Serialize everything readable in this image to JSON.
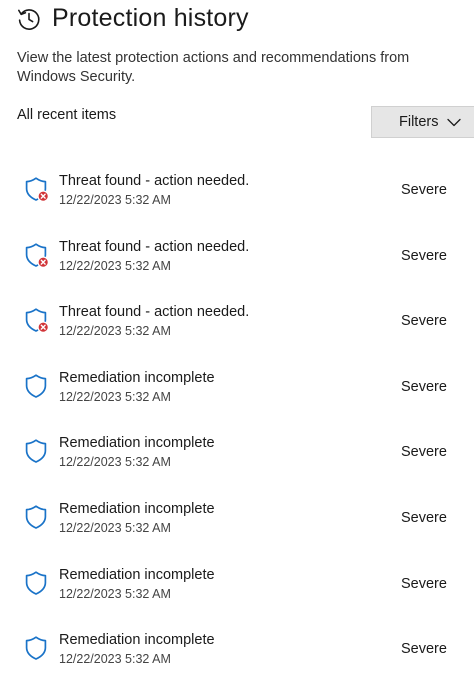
{
  "header": {
    "title": "Protection history",
    "icon": "history-icon",
    "description": "View the latest protection actions and recommendations from Windows Security."
  },
  "toolbar": {
    "section_label": "All recent items",
    "filters_label": "Filters"
  },
  "colors": {
    "shield": "#1a73c8",
    "danger": "#d13438"
  },
  "items": [
    {
      "title": "Threat found - action needed.",
      "time": "12/22/2023 5:32 AM",
      "severity": "Severe",
      "icon": "shield-alert-icon"
    },
    {
      "title": "Threat found - action needed.",
      "time": "12/22/2023 5:32 AM",
      "severity": "Severe",
      "icon": "shield-alert-icon"
    },
    {
      "title": "Threat found - action needed.",
      "time": "12/22/2023 5:32 AM",
      "severity": "Severe",
      "icon": "shield-alert-icon"
    },
    {
      "title": "Remediation incomplete",
      "time": "12/22/2023 5:32 AM",
      "severity": "Severe",
      "icon": "shield-icon"
    },
    {
      "title": "Remediation incomplete",
      "time": "12/22/2023 5:32 AM",
      "severity": "Severe",
      "icon": "shield-icon"
    },
    {
      "title": "Remediation incomplete",
      "time": "12/22/2023 5:32 AM",
      "severity": "Severe",
      "icon": "shield-icon"
    },
    {
      "title": "Remediation incomplete",
      "time": "12/22/2023 5:32 AM",
      "severity": "Severe",
      "icon": "shield-icon"
    },
    {
      "title": "Remediation incomplete",
      "time": "12/22/2023 5:32 AM",
      "severity": "Severe",
      "icon": "shield-icon"
    }
  ]
}
